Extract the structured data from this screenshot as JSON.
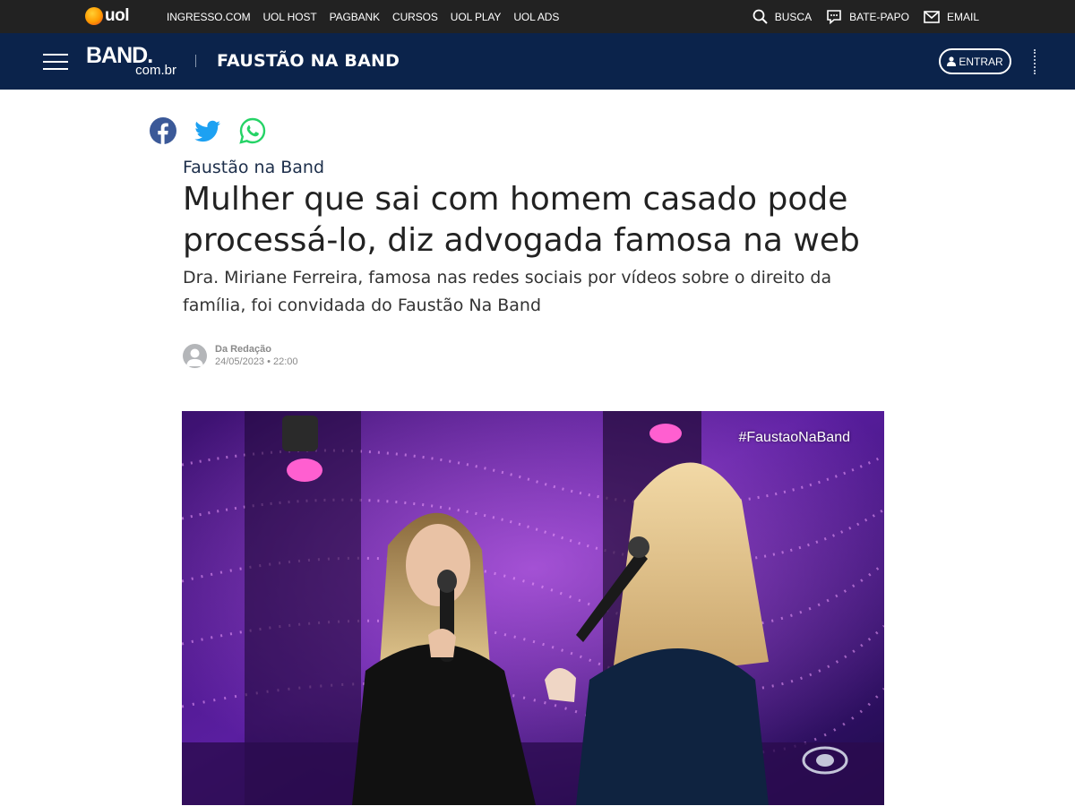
{
  "uol_bar": {
    "logo_text": "uol",
    "links": [
      "INGRESSO.COM",
      "UOL HOST",
      "PAGBANK",
      "CURSOS",
      "UOL PLAY",
      "UOL ADS"
    ],
    "right": [
      {
        "icon": "search-icon",
        "label": "BUSCA"
      },
      {
        "icon": "chat-icon",
        "label": "BATE-PAPO"
      },
      {
        "icon": "mail-icon",
        "label": "EMAIL"
      }
    ]
  },
  "band_bar": {
    "logo_main": "BAND.",
    "logo_sub": "com.br",
    "section": "FAUSTÃO NA BAND",
    "login_label": "ENTRAR"
  },
  "share": [
    "facebook-icon",
    "twitter-icon",
    "whatsapp-icon"
  ],
  "article": {
    "kicker": "Faustão na Band",
    "title": "Mulher que sai com homem casado pode processá-lo, diz advogada famosa na web",
    "subtitle": "Dra. Miriane Ferreira, famosa nas redes sociais por vídeos sobre o direito da família, foi convidada do Faustão Na Band",
    "author": "Da Redação",
    "date": "24/05/2023 • 22:00"
  },
  "media": {
    "hashtag": "#FaustaoNaBand"
  },
  "colors": {
    "uol_bar": "#222222",
    "band_bar": "#0b234b",
    "facebook": "#3b5998",
    "twitter": "#1da1f2",
    "whatsapp": "#25d366"
  }
}
